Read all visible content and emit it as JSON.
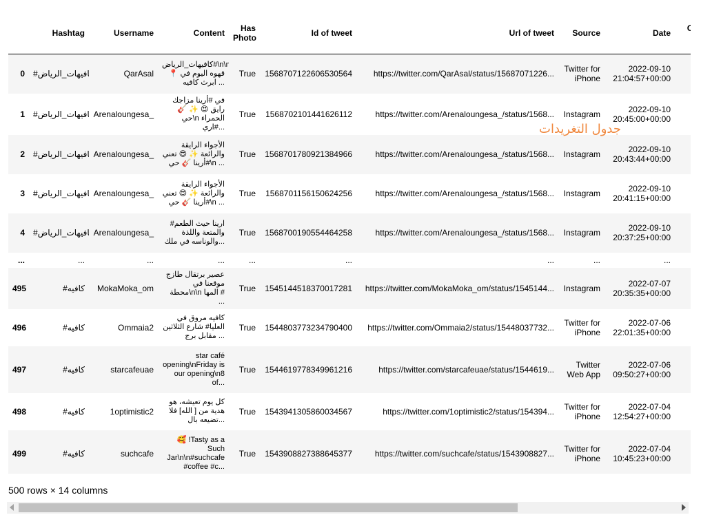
{
  "table": {
    "headers": [
      "",
      "Hashtag",
      "Username",
      "Content",
      "Has Photo",
      "Id of tweet",
      "Url of tweet",
      "Source",
      "Date",
      "Count of replies"
    ],
    "rows": [
      {
        "idx": "0",
        "hashtag": "#كافيهات_الرياض",
        "username": "QarAsal",
        "content": "كافيهات_الرياض#\\n\\n قهوه اليوم في 📍 ابرث كافيه ...",
        "has_photo": "True",
        "id": "1568707122606530564",
        "url": "https://twitter.com/QarAsal/status/15687071226...",
        "source": "Twitter for iPhone",
        "date": "2022-09-10 21:04:57+00:00"
      },
      {
        "idx": "1",
        "hashtag": "#كافيهات_الرياض",
        "username": "Arenaloungesa_",
        "content": "في #أرينا مزاجك رايق 😍 ✨ 🎸 حي\\n الحمراء #اري...",
        "has_photo": "True",
        "id": "1568702101441626112",
        "url": "https://twitter.com/Arenaloungesa_/status/1568...",
        "source": "Instagram",
        "date": "2022-09-10 20:45:00+00:00"
      },
      {
        "idx": "2",
        "hashtag": "#كافيهات_الرياض",
        "username": "Arenaloungesa_",
        "content": "الأجواء الرايقة والرائعة ✨ 😍 تعني #أرينا 🎸 حي\\n ...",
        "has_photo": "True",
        "id": "1568701780921384966",
        "url": "https://twitter.com/Arenaloungesa_/status/1568...",
        "source": "Instagram",
        "date": "2022-09-10 20:43:44+00:00"
      },
      {
        "idx": "3",
        "hashtag": "#كافيهات_الرياض",
        "username": "Arenaloungesa_",
        "content": "الأجواء الرايقة والرائعة ✨ 😍 تعني #أرينا 🎸 حي\\n ...",
        "has_photo": "True",
        "id": "1568701156150624256",
        "url": "https://twitter.com/Arenaloungesa_/status/1568...",
        "source": "Instagram",
        "date": "2022-09-10 20:41:15+00:00"
      },
      {
        "idx": "4",
        "hashtag": "#كافيهات_الرياض",
        "username": "Arenaloungesa_",
        "content": "ارينا حيث الطعم# والمتعة واللذة والوناسه في ملك...",
        "has_photo": "True",
        "id": "1568700190554464258",
        "url": "https://twitter.com/Arenaloungesa_/status/1568...",
        "source": "Instagram",
        "date": "2022-09-10 20:37:25+00:00"
      },
      {
        "idx": "495",
        "hashtag": "#كافيه",
        "username": "MokaMoka_om",
        "content": "عصير برتقال طازج موقعنا في محطة\\n\\n المها # ...",
        "has_photo": "True",
        "id": "1545144518370017281",
        "url": "https://twitter.com/MokaMoka_om/status/1545144...",
        "source": "Instagram",
        "date": "2022-07-07 20:35:35+00:00"
      },
      {
        "idx": "496",
        "hashtag": "#كافيه",
        "username": "Ommaia2",
        "content": "كافيه مروق في العليا# شارع الثلاثين مقابل برج ...",
        "has_photo": "True",
        "id": "1544803773234790400",
        "url": "https://twitter.com/Ommaia2/status/15448037732...",
        "source": "Twitter for iPhone",
        "date": "2022-07-06 22:01:35+00:00"
      },
      {
        "idx": "497",
        "hashtag": "#كافيه",
        "username": "starcafeuae",
        "content": "star café opening\\nFriday is our opening\\n8 of...",
        "has_photo": "True",
        "id": "1544619778349961216",
        "url": "https://twitter.com/starcafeuae/status/1544619...",
        "source": "Twitter Web App",
        "date": "2022-07-06 09:50:27+00:00"
      },
      {
        "idx": "498",
        "hashtag": "#كافيه",
        "username": "1optimistic2",
        "content": "كل يوم تعيشه، هو هدية من [ الله] فلا تضيعه بال...",
        "has_photo": "True",
        "id": "1543941305860034567",
        "url": "https://twitter.com/1optimistic2/status/154394...",
        "source": "Twitter for iPhone",
        "date": "2022-07-04 12:54:27+00:00"
      },
      {
        "idx": "499",
        "hashtag": "#كافيه",
        "username": "suchcafe",
        "content": "🥰 !Tasty as a Such Jar\\n\\n#suchcafe #coffee #c...",
        "has_photo": "True",
        "id": "1543908827388645377",
        "url": "https://twitter.com/suchcafe/status/1543908827...",
        "source": "Twitter for iPhone",
        "date": "2022-07-04 10:45:23+00:00"
      }
    ],
    "ellipsis": "...",
    "summary": "500 rows × 14 columns"
  },
  "overlay_label": "جدول التغريدات",
  "colors": {
    "overlay": "#f0883e",
    "stripe": "#f5f5f5",
    "scroll_thumb": "#c1c1c1"
  }
}
